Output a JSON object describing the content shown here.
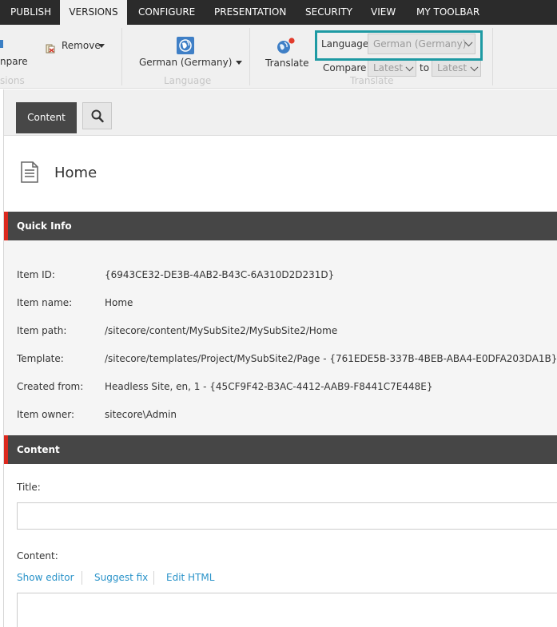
{
  "tabs": [
    "PUBLISH",
    "VERSIONS",
    "CONFIGURE",
    "PRESENTATION",
    "SECURITY",
    "VIEW",
    "MY TOOLBAR"
  ],
  "active_tab": "VERSIONS",
  "ribbon": {
    "versions_group": {
      "compare_label": "npare",
      "remove_label": "Remove",
      "group_label": "sions"
    },
    "language_group": {
      "button_label": "German (Germany)",
      "group_label": "Language"
    },
    "translate_group": {
      "translate_label": "Translate",
      "language_field_label": "Language",
      "language_value": "German (Germany)",
      "compare_label": "Compare",
      "compare_from": "Latest",
      "to_label": "to",
      "compare_to": "Latest",
      "group_label": "Translate"
    }
  },
  "editor": {
    "tabs": {
      "content_label": "Content"
    },
    "item_title": "Home",
    "quick_info": {
      "header": "Quick Info",
      "rows": [
        {
          "label": "Item ID:",
          "value": "{6943CE32-DE3B-4AB2-B43C-6A310D2D231D}"
        },
        {
          "label": "Item name:",
          "value": "Home"
        },
        {
          "label": "Item path:",
          "value": "/sitecore/content/MySubSite2/MySubSite2/Home"
        },
        {
          "label": "Template:",
          "value": "/sitecore/templates/Project/MySubSite2/Page - {761EDE5B-337B-4BEB-ABA4-E0DFA203DA1B}"
        },
        {
          "label": "Created from:",
          "value": "Headless Site, en, 1 - {45CF9F42-B3AC-4412-AAB9-F8441C7E448E}"
        },
        {
          "label": "Item owner:",
          "value": "sitecore\\Admin"
        }
      ]
    },
    "content_section": {
      "header": "Content",
      "title_label": "Title:",
      "title_value": "",
      "content_label": "Content:",
      "links": [
        "Show editor",
        "Suggest fix",
        "Edit HTML"
      ],
      "content_value": ""
    }
  },
  "colors": {
    "tabbar_bg": "#2b2b2b",
    "ribbon_bg": "#f0f0f0",
    "highlight_border": "#1e9aa3",
    "section_header_bg": "#464646",
    "section_accent": "#dc291e",
    "link": "#2a93c9"
  }
}
